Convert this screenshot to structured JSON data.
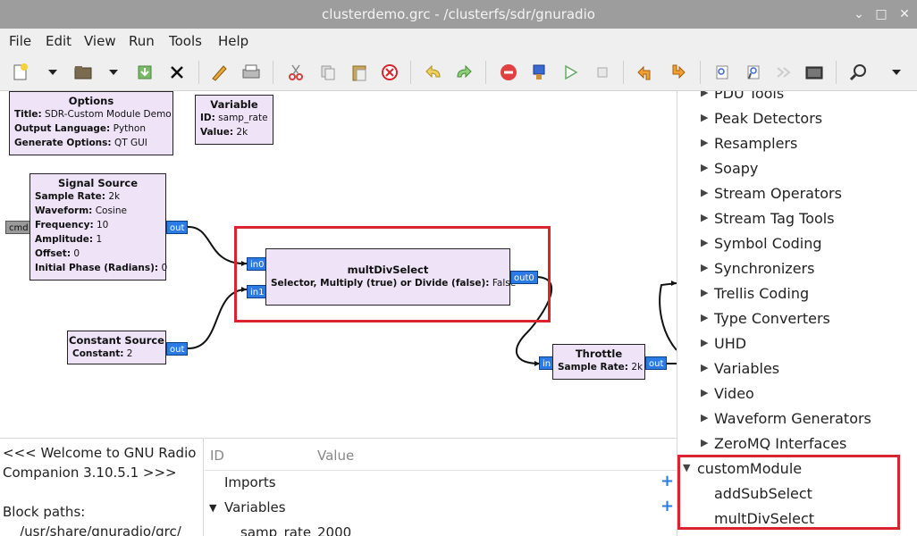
{
  "window": {
    "title": "clusterdemo.grc - /clusterfs/sdr/gnuradio"
  },
  "menu": [
    "File",
    "Edit",
    "View",
    "Run",
    "Tools",
    "Help"
  ],
  "toolbar": {
    "buttons": [
      "new-icon",
      "new-dropdown-icon",
      "open-icon",
      "open-dropdown-icon",
      "save-icon",
      "close-icon",
      "edit-icon",
      "print-icon",
      "cut-icon",
      "copy-icon",
      "paste-icon",
      "delete-icon",
      "undo-icon",
      "redo-icon",
      "stop-icon",
      "generate-icon",
      "execute-icon",
      "kill-icon",
      "rotate-ccw-icon",
      "rotate-cw-icon",
      "enable-icon",
      "disable-icon",
      "bypass-icon",
      "screenshot-icon",
      "find-icon",
      "more-icon"
    ]
  },
  "blocks": {
    "options": {
      "title": "Options",
      "params": [
        {
          "k": "Title:",
          "v": "SDR-Custom Module Demo"
        },
        {
          "k": "Output Language:",
          "v": "Python"
        },
        {
          "k": "Generate Options:",
          "v": "QT GUI"
        }
      ]
    },
    "variable": {
      "title": "Variable",
      "params": [
        {
          "k": "ID:",
          "v": "samp_rate"
        },
        {
          "k": "Value:",
          "v": "2k"
        }
      ]
    },
    "signal_source": {
      "title": "Signal Source",
      "params": [
        {
          "k": "Sample Rate:",
          "v": "2k"
        },
        {
          "k": "Waveform:",
          "v": "Cosine"
        },
        {
          "k": "Frequency:",
          "v": "10"
        },
        {
          "k": "Amplitude:",
          "v": "1"
        },
        {
          "k": "Offset:",
          "v": "0"
        },
        {
          "k": "Initial Phase (Radians):",
          "v": "0"
        }
      ],
      "in_port": "cmd",
      "out_port": "out"
    },
    "mult_div_select": {
      "title": "multDivSelect",
      "params": [
        {
          "k": "Selector, Multiply (true) or Divide (false):",
          "v": "False"
        }
      ],
      "in_ports": [
        "in0",
        "in1"
      ],
      "out_port": "out0"
    },
    "constant_source": {
      "title": "Constant Source",
      "params": [
        {
          "k": "Constant:",
          "v": "2"
        }
      ],
      "out_port": "out"
    },
    "throttle": {
      "title": "Throttle",
      "params": [
        {
          "k": "Sample Rate:",
          "v": "2k"
        }
      ],
      "in_port": "in",
      "out_port": "out"
    }
  },
  "console": {
    "lines": [
      "<<< Welcome to GNU Radio",
      "Companion 3.10.5.1 >>>",
      "",
      "Block paths:",
      "    /usr/share/gnuradio/grc/"
    ]
  },
  "variables_panel": {
    "col_id": "ID",
    "col_value": "Value",
    "rows": [
      {
        "label": "Imports",
        "expanded": false
      },
      {
        "label": "Variables",
        "expanded": true
      },
      {
        "label": "samp_rate",
        "value": "2000"
      }
    ]
  },
  "tree": {
    "categories": [
      "PDU Tools",
      "Peak Detectors",
      "Resamplers",
      "Soapy",
      "Stream Operators",
      "Stream Tag Tools",
      "Symbol Coding",
      "Synchronizers",
      "Trellis Coding",
      "Type Converters",
      "UHD",
      "Variables",
      "Video",
      "Waveform Generators",
      "ZeroMQ Interfaces"
    ],
    "custom_module": {
      "label": "customModule",
      "children": [
        "addSubSelect",
        "multDivSelect"
      ]
    }
  },
  "colors": {
    "highlight": "#d9232e",
    "port": "#2c7be5",
    "block_bg": "#eee3f7"
  }
}
